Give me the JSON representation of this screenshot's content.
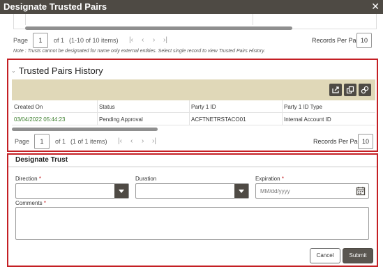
{
  "window": {
    "title": "Designate Trusted Pairs",
    "close_icon": "close-icon"
  },
  "top_pager": {
    "page_label": "Page",
    "page_value": "1",
    "of_label": "of 1",
    "items_label": "(1-10 of 10 items)",
    "rpp_label": "Records Per Page",
    "rpp_value": "10"
  },
  "note": "Note : Trusts cannot be designated for name only external entities. Select single record to view Trusted Pairs History.",
  "history": {
    "title": "Trusted Pairs History",
    "toolbar_icons": [
      "export-icon",
      "copy-icon",
      "link-icon"
    ],
    "columns": [
      "Created On",
      "Status",
      "Party 1 ID",
      "Party 1 ID Type"
    ],
    "rows": [
      [
        "03/04/2022 05:44:23",
        "Pending Approval",
        "ACFTNETRSTACO01",
        "Internal Account ID"
      ]
    ],
    "pager": {
      "page_label": "Page",
      "page_value": "1",
      "of_label": "of 1",
      "items_label": "(1 of 1 items)",
      "rpp_label": "Records Per Page",
      "rpp_value": "10"
    }
  },
  "designate": {
    "title": "Designate Trust",
    "direction_label": "Direction",
    "duration_label": "Duration",
    "expiration_label": "Expiration",
    "expiration_placeholder": "MM/dd/yyyy",
    "comments_label": "Comments",
    "required_mark": "*",
    "cancel_label": "Cancel",
    "submit_label": "Submit"
  },
  "colors": {
    "titlebar": "#4e4a44",
    "panel_border": "#c41f24",
    "toolbar_bg": "#e0d8b8",
    "date_green": "#3a7d2b"
  }
}
